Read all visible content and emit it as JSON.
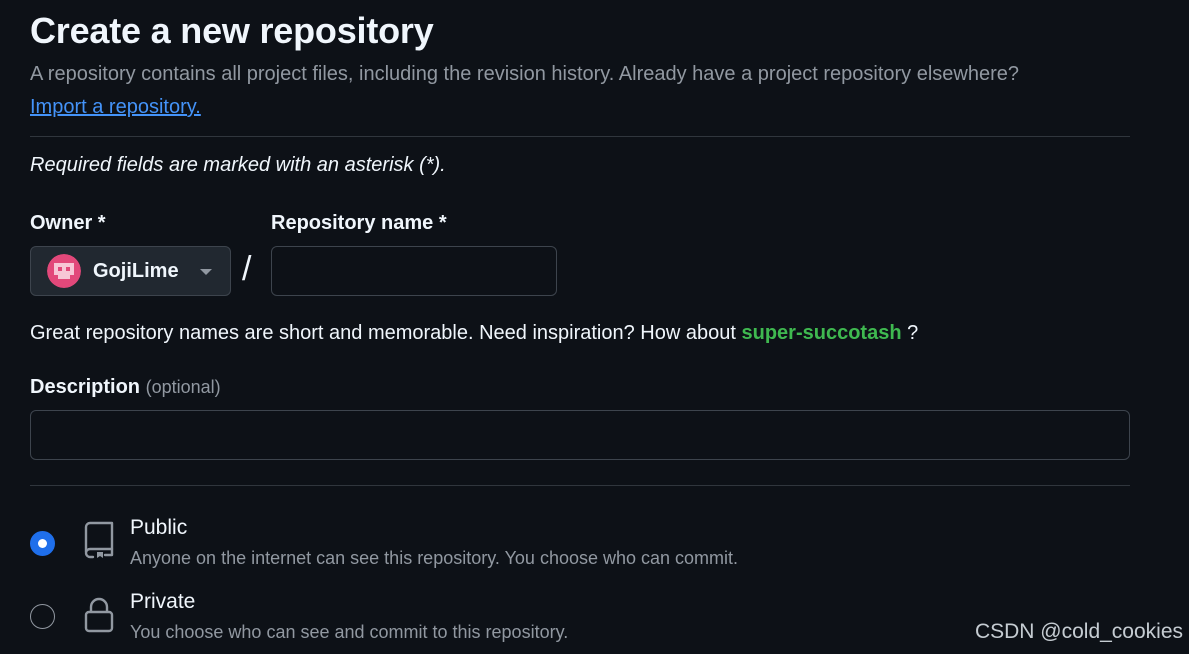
{
  "header": {
    "title": "Create a new repository",
    "subtitle": "A repository contains all project files, including the revision history. Already have a project repository elsewhere?",
    "import_link": "Import a repository."
  },
  "form": {
    "required_note": "Required fields are marked with an asterisk (*).",
    "owner": {
      "label": "Owner *",
      "value": "GojiLime"
    },
    "separator": "/",
    "repo_name": {
      "label": "Repository name *",
      "value": ""
    },
    "hint": {
      "prefix": "Great repository names are short and memorable. Need inspiration? How about ",
      "suggestion": "super-succotash",
      "suffix": " ?"
    },
    "description": {
      "label": "Description",
      "optional": "(optional)",
      "value": ""
    },
    "visibility": {
      "selected": "Public",
      "options": [
        {
          "title": "Public",
          "description": "Anyone on the internet can see this repository. You choose who can commit.",
          "icon": "repo-icon"
        },
        {
          "title": "Private",
          "description": "You choose who can see and commit to this repository.",
          "icon": "lock-icon"
        }
      ]
    }
  },
  "watermark": "CSDN @cold_cookies",
  "colors": {
    "background": "#0d1117",
    "link": "#4493f8",
    "suggestion": "#3fb950",
    "radio_checked": "#1f6feb",
    "avatar": "#e2487a"
  }
}
